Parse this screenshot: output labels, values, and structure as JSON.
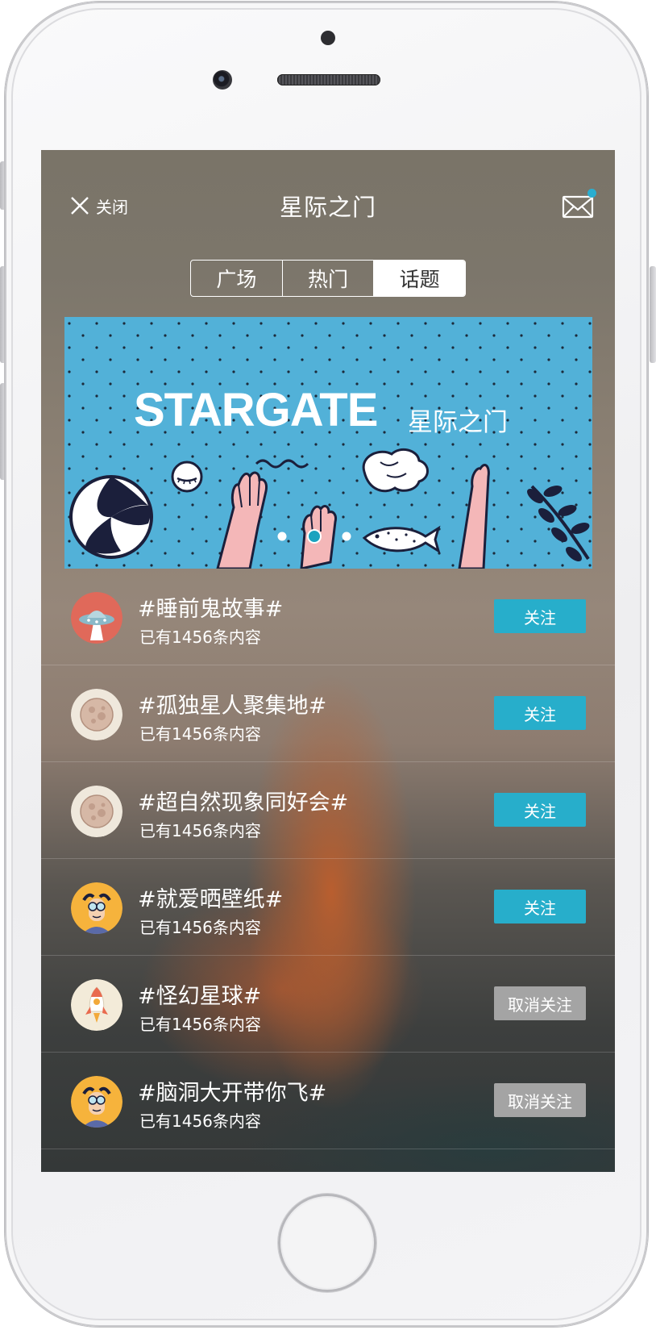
{
  "header": {
    "close_label": "关闭",
    "title": "星际之门",
    "has_unread_mail": true
  },
  "tabs": [
    {
      "label": "广场",
      "active": false
    },
    {
      "label": "热门",
      "active": false
    },
    {
      "label": "话题",
      "active": true
    }
  ],
  "banner": {
    "title_en": "STARGATE",
    "title_cn": "星际之门",
    "page_indicator": {
      "count": 3,
      "active_index": 1
    }
  },
  "topics": [
    {
      "title": "#睡前鬼故事#",
      "subtitle": "已有1456条内容",
      "button": "关注",
      "following": false,
      "avatar": "ufo-icon"
    },
    {
      "title": "#孤独星人聚集地#",
      "subtitle": "已有1456条内容",
      "button": "关注",
      "following": false,
      "avatar": "moon-icon"
    },
    {
      "title": "#超自然现象同好会#",
      "subtitle": "已有1456条内容",
      "button": "关注",
      "following": false,
      "avatar": "moon-icon"
    },
    {
      "title": "#就爱晒壁纸#",
      "subtitle": "已有1456条内容",
      "button": "关注",
      "following": false,
      "avatar": "scientist-icon"
    },
    {
      "title": "#怪幻星球#",
      "subtitle": "已有1456条内容",
      "button": "取消关注",
      "following": true,
      "avatar": "rocket-icon"
    },
    {
      "title": "#脑洞大开带你飞#",
      "subtitle": "已有1456条内容",
      "button": "取消关注",
      "following": true,
      "avatar": "scientist-icon"
    }
  ],
  "colors": {
    "accent": "#27aecb",
    "unfollow_gray": "#a4a4a4",
    "banner_blue": "#52b1d8",
    "mail_dot": "#2aaed0"
  }
}
